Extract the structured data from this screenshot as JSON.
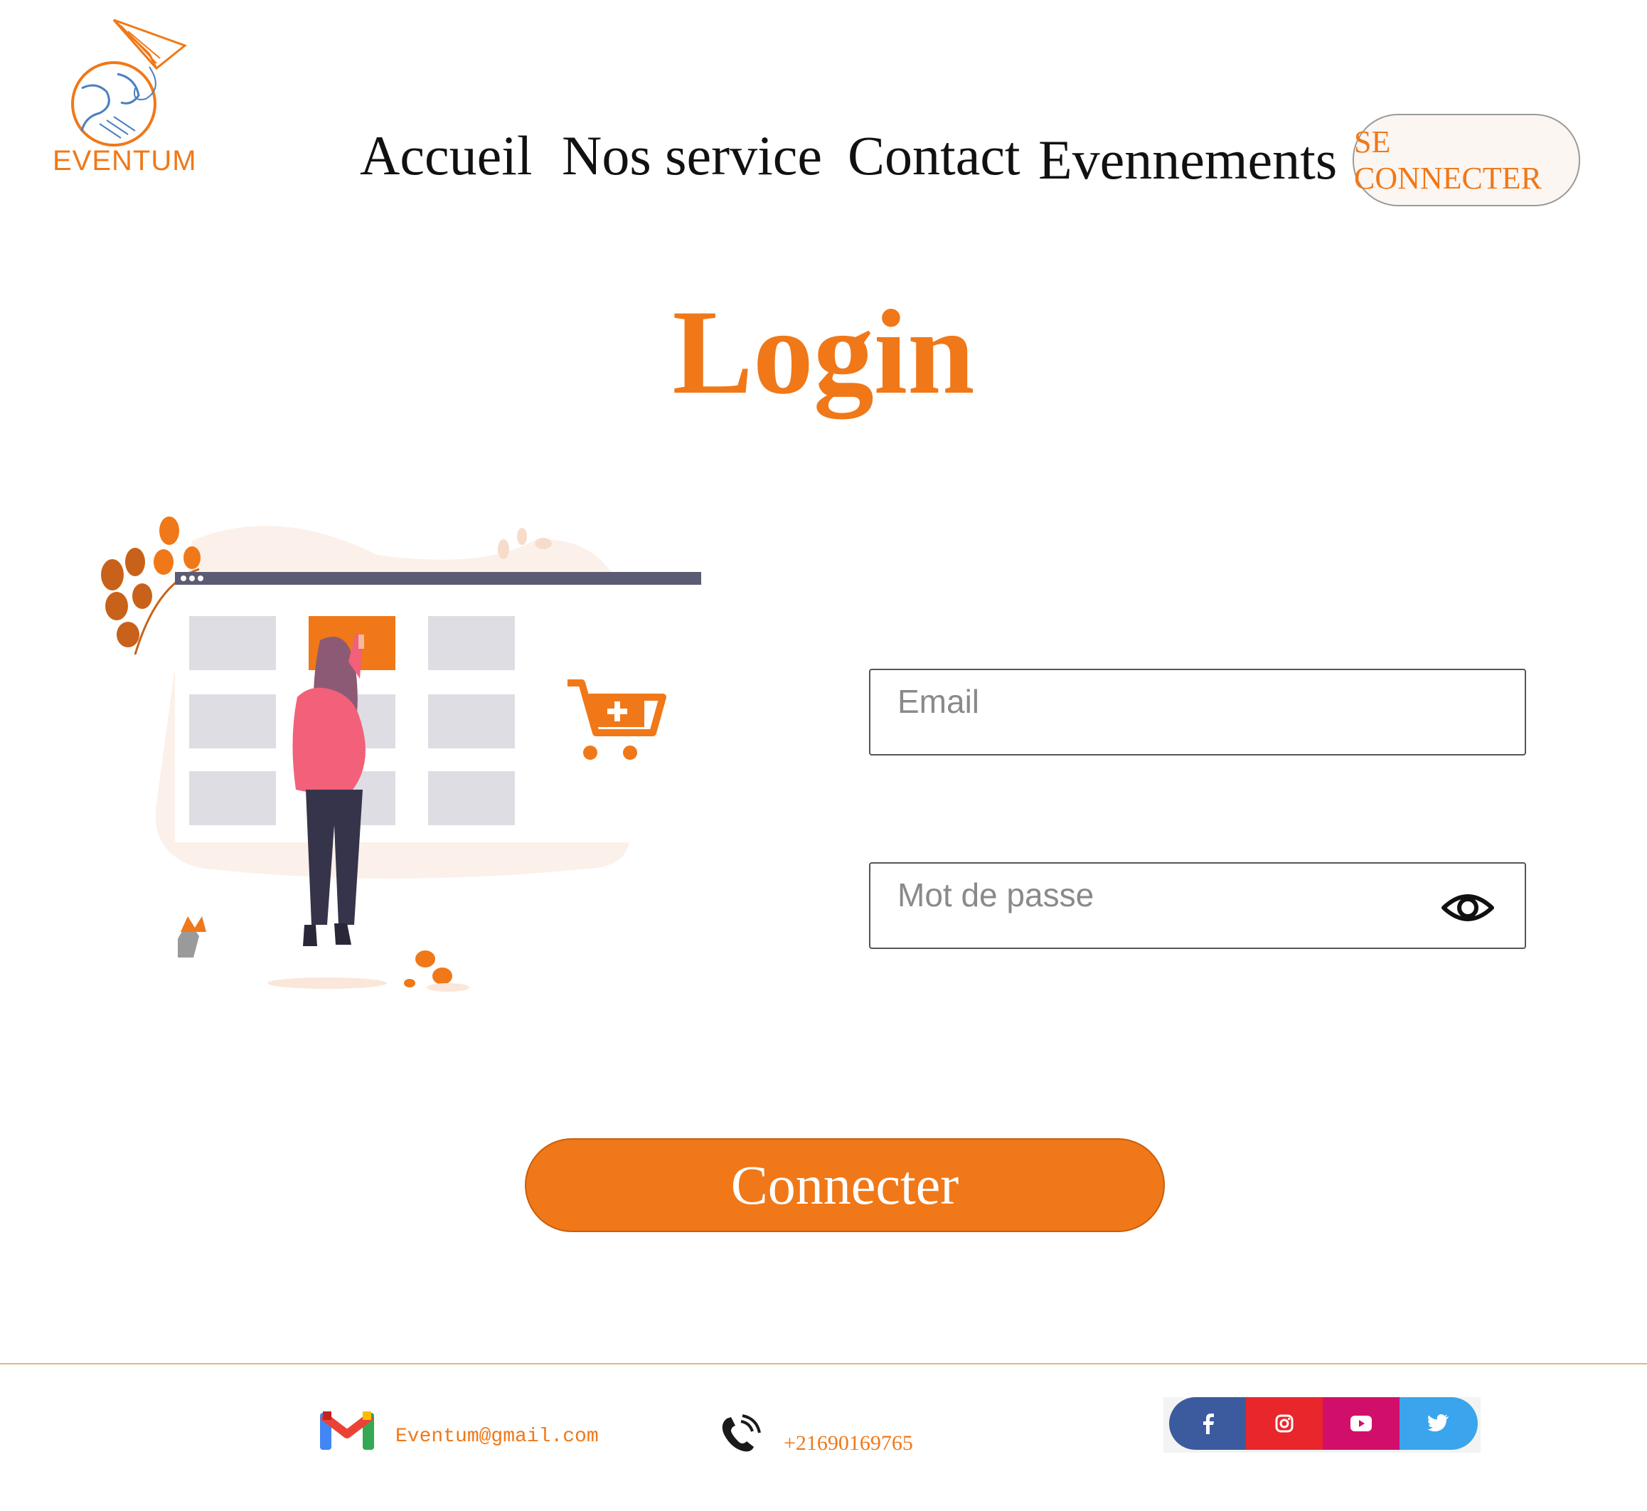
{
  "brand": {
    "name": "EVENTUM",
    "accent_color": "#f07818"
  },
  "nav": {
    "items": [
      {
        "label": "Accueil"
      },
      {
        "label": "Nos service"
      },
      {
        "label": "Contact"
      },
      {
        "label": "Evennements"
      }
    ],
    "login_button": "SE CONNECTER"
  },
  "page": {
    "title": "Login"
  },
  "form": {
    "email_placeholder": "Email",
    "email_value": "",
    "password_placeholder": "Mot de passe",
    "password_value": "",
    "toggle_icon": "eye-icon",
    "submit_label": "Connecter"
  },
  "footer": {
    "email": "Eventum@gmail.com",
    "phone": "+21690169765",
    "socials": [
      "facebook-icon",
      "instagram-icon",
      "youtube-icon",
      "twitter-icon"
    ],
    "social_colors": [
      "#3b5b9e",
      "#e8262c",
      "#d10f6a",
      "#3aa5ec"
    ]
  }
}
